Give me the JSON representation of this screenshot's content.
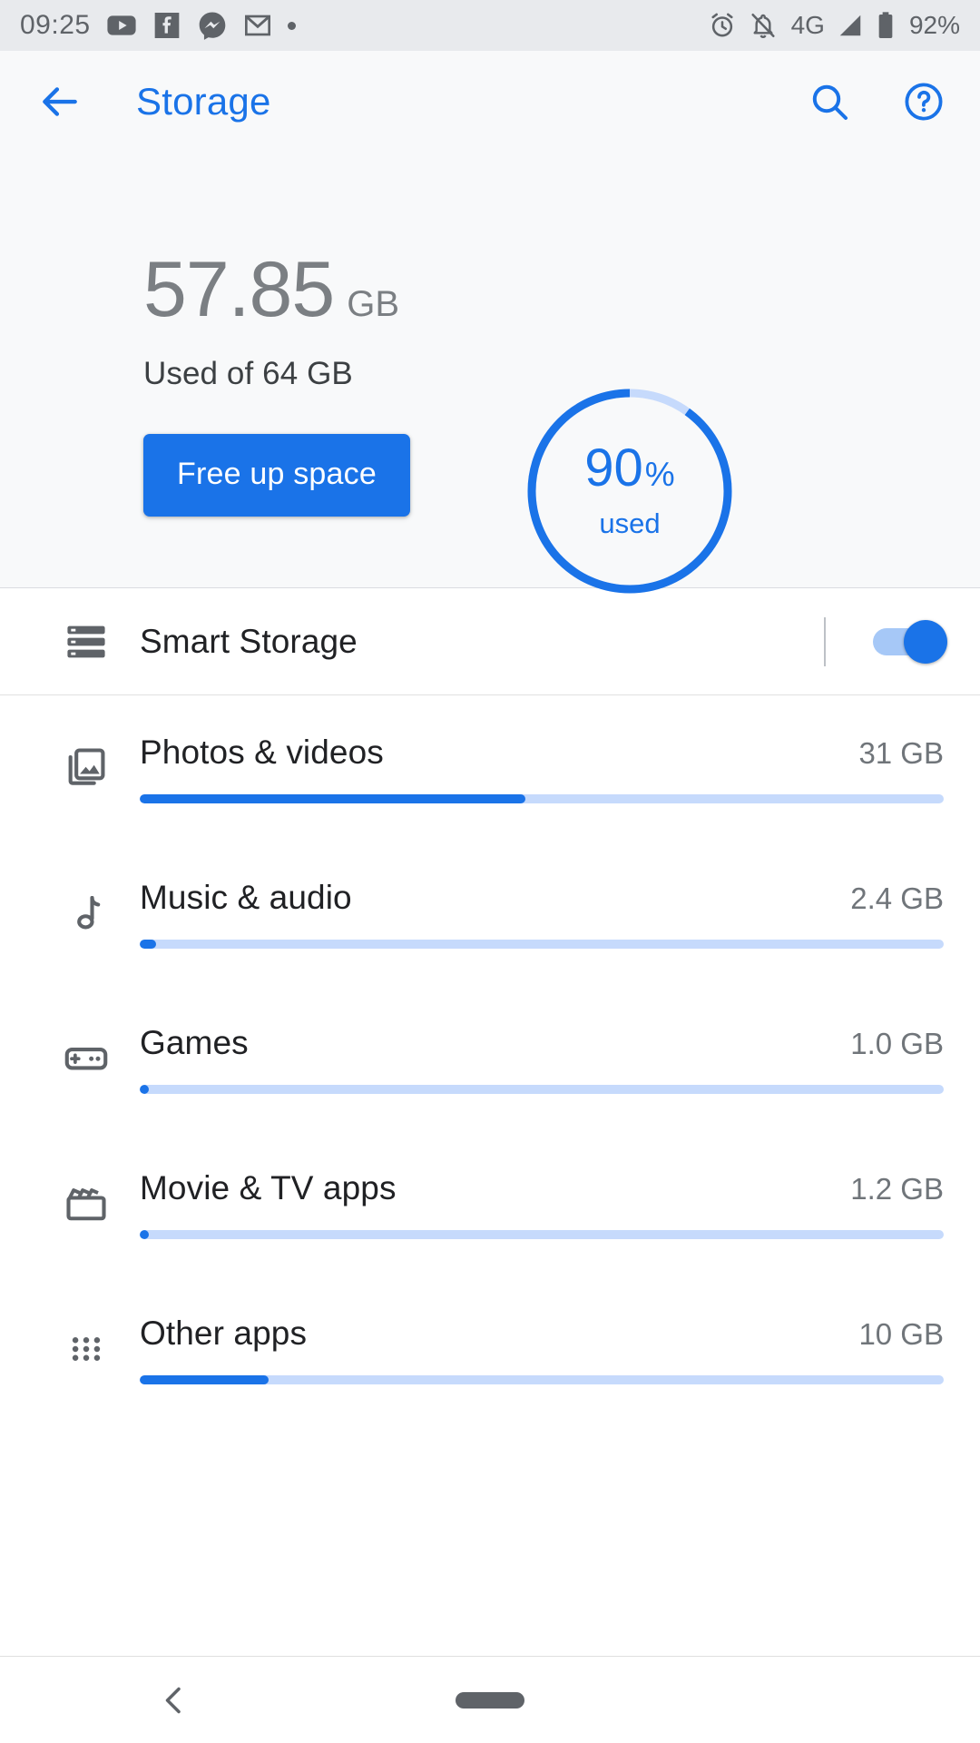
{
  "status_bar": {
    "time": "09:25",
    "left_icons": [
      "youtube-icon",
      "facebook-icon",
      "messenger-icon",
      "gmail-icon",
      "dot-indicator"
    ],
    "right_icons": [
      "alarm-icon",
      "notifications-muted-icon",
      "signal-icon"
    ],
    "network_type": "4G",
    "battery_percent": "92%"
  },
  "toolbar": {
    "back_label": "back-arrow",
    "title": "Storage",
    "search_label": "search-icon",
    "help_label": "help-icon"
  },
  "hero": {
    "used_value": "57.85",
    "used_unit": "GB",
    "capacity_line": "Used of 64 GB",
    "free_up_label": "Free up space",
    "gauge_percent": "90",
    "gauge_percent_symbol": "%",
    "gauge_caption": "used"
  },
  "smart_storage": {
    "label": "Smart Storage",
    "icon": "storage-stack-icon",
    "toggle_state": "on"
  },
  "categories": [
    {
      "icon": "photos-icon",
      "label": "Photos & videos",
      "size": "31 GB",
      "bar_percent": 48
    },
    {
      "icon": "music-icon",
      "label": "Music & audio",
      "size": "2.4 GB",
      "bar_percent": 2
    },
    {
      "icon": "games-icon",
      "label": "Games",
      "size": "1.0 GB",
      "bar_percent": 1
    },
    {
      "icon": "movie-icon",
      "label": "Movie & TV apps",
      "size": "1.2 GB",
      "bar_percent": 1
    },
    {
      "icon": "apps-grid-icon",
      "label": "Other apps",
      "size": "10 GB",
      "bar_percent": 16
    }
  ],
  "nav_bar": {
    "back_label": "nav-back-chevron",
    "home_label": "home-pill"
  },
  "colors": {
    "accent": "#1a73e8",
    "track": "#c6dafc",
    "status_bar_bg": "#e8eaed",
    "hero_bg": "#f8f9fa",
    "text_primary": "#202124",
    "text_secondary": "#70757a"
  },
  "chart_data": {
    "type": "bar",
    "title": "Storage usage by category",
    "categories": [
      "Photos & videos",
      "Music & audio",
      "Games",
      "Movie & TV apps",
      "Other apps"
    ],
    "values": [
      31,
      2.4,
      1.0,
      1.2,
      10
    ],
    "unit": "GB",
    "total_capacity": 64,
    "total_used": 57.85,
    "used_percent": 90,
    "xlabel": "",
    "ylabel": "GB",
    "ylim": [
      0,
      64
    ]
  }
}
